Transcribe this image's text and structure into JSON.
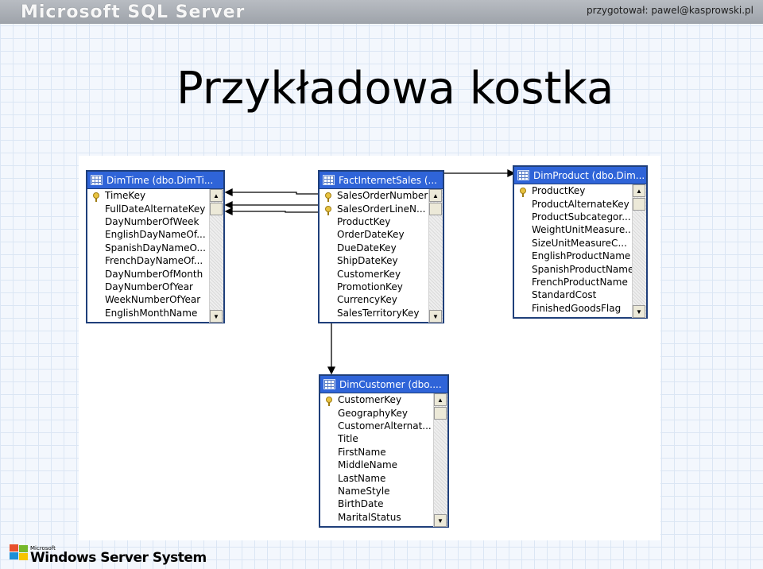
{
  "header": {
    "brand": "Microsoft SQL Server",
    "author": "przygotował: pawel@kasprowski.pl"
  },
  "slide": {
    "title": "Przykładowa kostka"
  },
  "footer": {
    "small": "Microsoft",
    "text": "Windows Server System"
  },
  "tables": {
    "dimtime": {
      "title": "DimTime (dbo.DimTi...",
      "rows": [
        {
          "name": "TimeKey",
          "key": true
        },
        {
          "name": "FullDateAlternateKey",
          "key": false
        },
        {
          "name": "DayNumberOfWeek",
          "key": false
        },
        {
          "name": "EnglishDayNameOf...",
          "key": false
        },
        {
          "name": "SpanishDayNameO...",
          "key": false
        },
        {
          "name": "FrenchDayNameOf...",
          "key": false
        },
        {
          "name": "DayNumberOfMonth",
          "key": false
        },
        {
          "name": "DayNumberOfYear",
          "key": false
        },
        {
          "name": "WeekNumberOfYear",
          "key": false
        },
        {
          "name": "EnglishMonthName",
          "key": false
        }
      ]
    },
    "fact": {
      "title": "FactInternetSales (...",
      "rows": [
        {
          "name": "SalesOrderNumber",
          "key": true
        },
        {
          "name": "SalesOrderLineN...",
          "key": true
        },
        {
          "name": "ProductKey",
          "key": false
        },
        {
          "name": "OrderDateKey",
          "key": false
        },
        {
          "name": "DueDateKey",
          "key": false
        },
        {
          "name": "ShipDateKey",
          "key": false
        },
        {
          "name": "CustomerKey",
          "key": false
        },
        {
          "name": "PromotionKey",
          "key": false
        },
        {
          "name": "CurrencyKey",
          "key": false
        },
        {
          "name": "SalesTerritoryKey",
          "key": false
        }
      ]
    },
    "dimproduct": {
      "title": "DimProduct (dbo.Dim...",
      "rows": [
        {
          "name": "ProductKey",
          "key": true
        },
        {
          "name": "ProductAlternateKey",
          "key": false
        },
        {
          "name": "ProductSubcategor...",
          "key": false
        },
        {
          "name": "WeightUnitMeasure...",
          "key": false
        },
        {
          "name": "SizeUnitMeasureC...",
          "key": false
        },
        {
          "name": "EnglishProductName",
          "key": false
        },
        {
          "name": "SpanishProductName",
          "key": false
        },
        {
          "name": "FrenchProductName",
          "key": false
        },
        {
          "name": "StandardCost",
          "key": false
        },
        {
          "name": "FinishedGoodsFlag",
          "key": false
        }
      ]
    },
    "dimcustomer": {
      "title": "DimCustomer (dbo....",
      "rows": [
        {
          "name": "CustomerKey",
          "key": true
        },
        {
          "name": "GeographyKey",
          "key": false
        },
        {
          "name": "CustomerAlternat...",
          "key": false
        },
        {
          "name": "Title",
          "key": false
        },
        {
          "name": "FirstName",
          "key": false
        },
        {
          "name": "MiddleName",
          "key": false
        },
        {
          "name": "LastName",
          "key": false
        },
        {
          "name": "NameStyle",
          "key": false
        },
        {
          "name": "BirthDate",
          "key": false
        },
        {
          "name": "MaritalStatus",
          "key": false
        }
      ]
    }
  }
}
